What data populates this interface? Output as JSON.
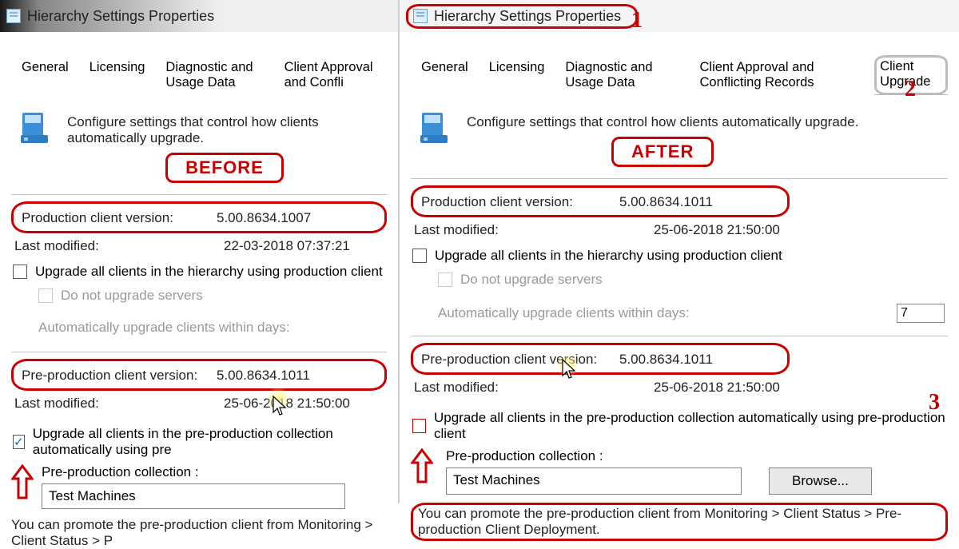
{
  "common": {
    "title": "Hierarchy Settings Properties",
    "intro": "Configure settings that control how clients automatically upgrade.",
    "tabs": {
      "general": "General",
      "licensing": "Licensing",
      "diag": "Diagnostic and Usage Data",
      "approval_short": "Client Approval and Confli",
      "approval_full": "Client Approval and Conflicting Records",
      "upgrade": "Client Upgrade"
    },
    "labels": {
      "prod_version": "Production client version:",
      "last_modified": "Last modified:",
      "preprod_version": "Pre-production client version:",
      "upgrade_all_prod": "Upgrade all clients in the hierarchy using production client",
      "no_upgrade_servers": "Do not upgrade servers",
      "auto_days": "Automatically upgrade clients within days:",
      "upgrade_all_preprod_short": "Upgrade all clients in the pre-production collection automatically using pre",
      "upgrade_all_preprod_full": "Upgrade all clients in the pre-production collection automatically using pre-production client",
      "preprod_collection": "Pre-production collection :",
      "collection_value": "Test Machines",
      "promote_note_short": "You can promote the pre-production client from Monitoring > Client Status > P",
      "promote_note_full": "You can promote the pre-production client from Monitoring > Client Status > Pre-production Client Deployment.",
      "browse": "Browse...",
      "days_value": "7"
    }
  },
  "before": {
    "stamp": "BEFORE",
    "prod_version": "5.00.8634.1007",
    "prod_modified": "22-03-2018 07:37:21",
    "preprod_version": "5.00.8634.1011",
    "preprod_modified": "25-06-2018 21:50:00",
    "preprod_checked": true
  },
  "after": {
    "stamp": "AFTER",
    "prod_version": "5.00.8634.1011",
    "prod_modified": "25-06-2018 21:50:00",
    "preprod_version": "5.00.8634.1011",
    "preprod_modified": "25-06-2018 21:50:00",
    "preprod_checked": false,
    "callouts": {
      "one": "1",
      "two": "2",
      "three": "3"
    }
  }
}
